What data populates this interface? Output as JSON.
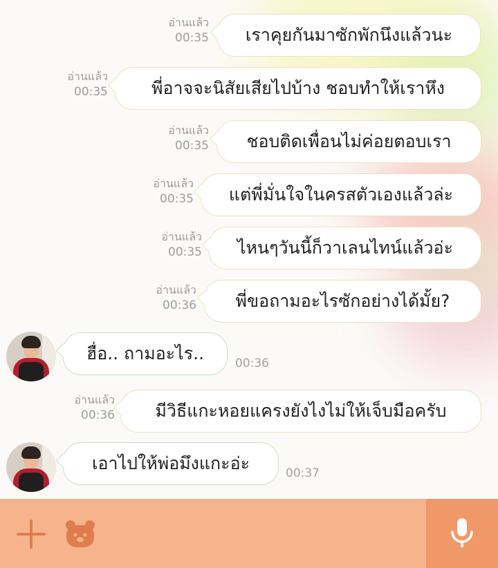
{
  "messages": [
    {
      "side": "out",
      "read": "อ่านแล้ว",
      "time": "00:35",
      "text": "เราคุยกันมาซักพักนึงแล้วนะ"
    },
    {
      "side": "out",
      "read": "อ่านแล้ว",
      "time": "00:35",
      "text": "พี่อาจจะนิสัยเสียไปบ้าง ชอบทำให้เราหึง"
    },
    {
      "side": "out",
      "read": "อ่านแล้ว",
      "time": "00:35",
      "text": "ชอบติดเพื่อนไม่ค่อยตอบเรา"
    },
    {
      "side": "out",
      "read": "อ่านแล้ว",
      "time": "00:35",
      "text": "แต่พี่มั่นใจในครสตัวเองแล้วล่ะ"
    },
    {
      "side": "out",
      "read": "อ่านแล้ว",
      "time": "00:35",
      "text": "ไหนๆวันนี้ก็วาเลนไทน์แล้วอ่ะ"
    },
    {
      "side": "out",
      "read": "อ่านแล้ว",
      "time": "00:36",
      "text": "พี่ขอถามอะไรซักอย่างได้มั้ย?"
    },
    {
      "side": "in",
      "time": "00:36",
      "text": "ฮื่อ.. ถามอะไร.."
    },
    {
      "side": "out",
      "read": "อ่านแล้ว",
      "time": "00:36",
      "text": "มีวิธีแกะหอยแครงยังไงไม่ให้เจ็บมือครับ"
    },
    {
      "side": "in",
      "time": "00:37",
      "text": "เอาไปให้พ่อมึงแกะอ่ะ"
    }
  ],
  "input_bar": {
    "plus_icon": "plus-icon",
    "sticker_icon": "bear-sticker-icon",
    "mic_icon": "microphone-icon",
    "accent": "#f7b48c",
    "mic_bg": "#f09868"
  }
}
